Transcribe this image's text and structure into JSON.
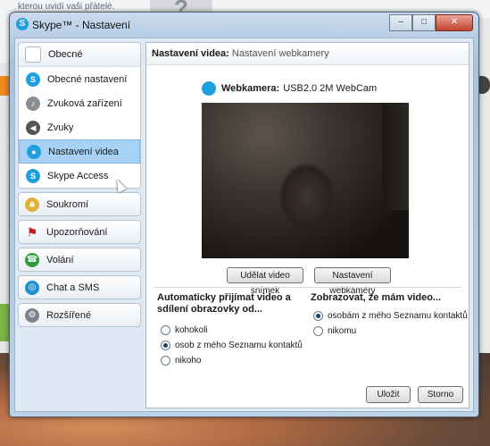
{
  "window": {
    "title": "Skype™ - Nastavení",
    "minimize": "–",
    "maximize": "□",
    "close": "✕"
  },
  "background": {
    "snippet": "kterou uvidí vaši přátelé."
  },
  "sidebar": {
    "general": {
      "label": "Obecné",
      "items": [
        {
          "label": "Obecné nastavení",
          "icon": "skype-icon"
        },
        {
          "label": "Zvuková zařízení",
          "icon": "microphone-icon"
        },
        {
          "label": "Zvuky",
          "icon": "speaker-icon"
        },
        {
          "label": "Nastavení videa",
          "icon": "webcam-icon",
          "active": true
        },
        {
          "label": "Skype Access",
          "icon": "wifi-icon"
        }
      ]
    },
    "categories": [
      {
        "label": "Soukromí",
        "icon": "lock-icon"
      },
      {
        "label": "Upozorňování",
        "icon": "flag-icon"
      },
      {
        "label": "Volání",
        "icon": "phone-icon"
      },
      {
        "label": "Chat a SMS",
        "icon": "chat-icon"
      },
      {
        "label": "Rozšířené",
        "icon": "gear-icon"
      }
    ]
  },
  "panel": {
    "header_bold": "Nastavení videa:",
    "header_sub": "Nastavení webkamery",
    "webcam_label": "Webkamera:",
    "webcam_name": "USB2.0 2M WebCam",
    "snapshot_button": "Udělat video snímek",
    "webcam_settings_button": "Nastavení webkamery",
    "receive": {
      "title": "Automaticky přijímat video a sdílení obrazovky od...",
      "options": [
        "kohokoli",
        "osob z mého Seznamu kontaktů",
        "nikoho"
      ],
      "selected": 1
    },
    "show": {
      "title": "Zobrazovat, že mám video...",
      "options": [
        "osobám z mého Seznamu kontaktů",
        "nikomu"
      ],
      "selected": 0
    }
  },
  "footer": {
    "save": "Uložit",
    "cancel": "Storno"
  }
}
